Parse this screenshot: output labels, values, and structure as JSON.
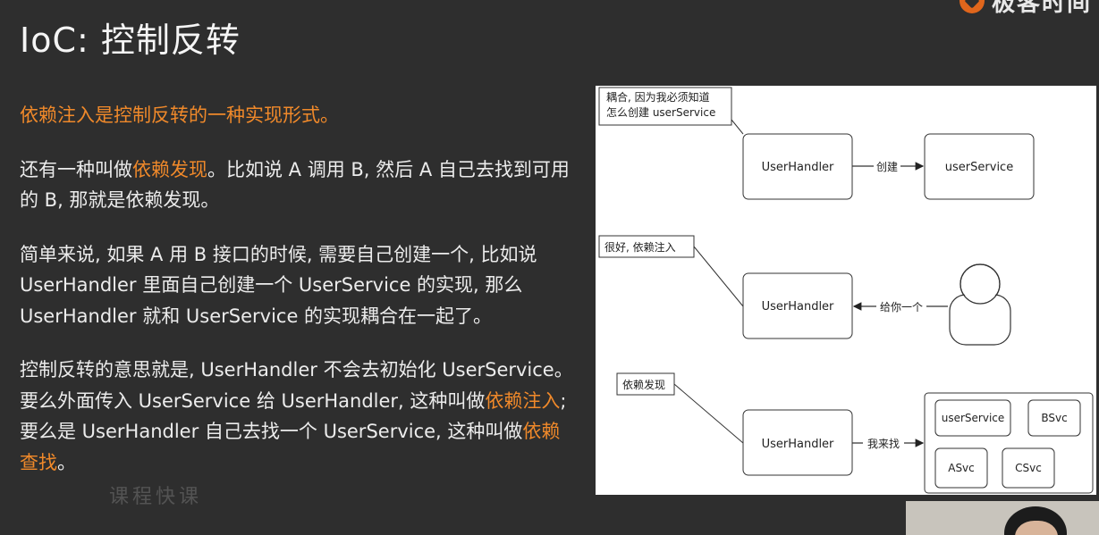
{
  "slide": {
    "title": "IoC: 控制反转",
    "logo_text": "极客时间"
  },
  "paragraphs": {
    "p1": "依赖注入是控制反转的一种实现形式。",
    "p2_a": "还有一种叫做",
    "p2_hl": "依赖发现",
    "p2_b": "。比如说 A 调用 B, 然后 A 自己去找到可用的 B, 那就是依赖发现。",
    "p3": "简单来说, 如果 A 用 B 接口的时候, 需要自己创建一个, 比如说 UserHandler 里面自己创建一个 UserService 的实现, 那么 UserHandler 就和 UserService 的实现耦合在一起了。",
    "p4_a": "控制反转的意思就是, UserHandler 不会去初始化 UserService。要么外面传入 UserService 给 UserHandler, 这种叫做",
    "p4_hl1": "依赖注入",
    "p4_b": "; 要么是 UserHandler 自己去找一个 UserService, 这种叫做",
    "p4_hl2": "依赖查找",
    "p4_c": "。"
  },
  "watermark": "课程快课",
  "diagram": {
    "note1_line1": "耦合, 因为我必须知道",
    "note1_line2": "怎么创建 userService",
    "box1": "UserHandler",
    "arrow1": "创建",
    "box2": "userService",
    "note2": "很好, 依赖注入",
    "box3": "UserHandler",
    "arrow2": "给你一个",
    "note3": "依赖发现",
    "box4": "UserHandler",
    "arrow3": "我来找",
    "svc_userService": "userService",
    "svc_bsvc": "BSvc",
    "svc_asvc": "ASvc",
    "svc_csvc": "CSvc"
  },
  "colors": {
    "background": "#2e2e2e",
    "accent_orange": "#f0892a",
    "text": "#ececec"
  }
}
